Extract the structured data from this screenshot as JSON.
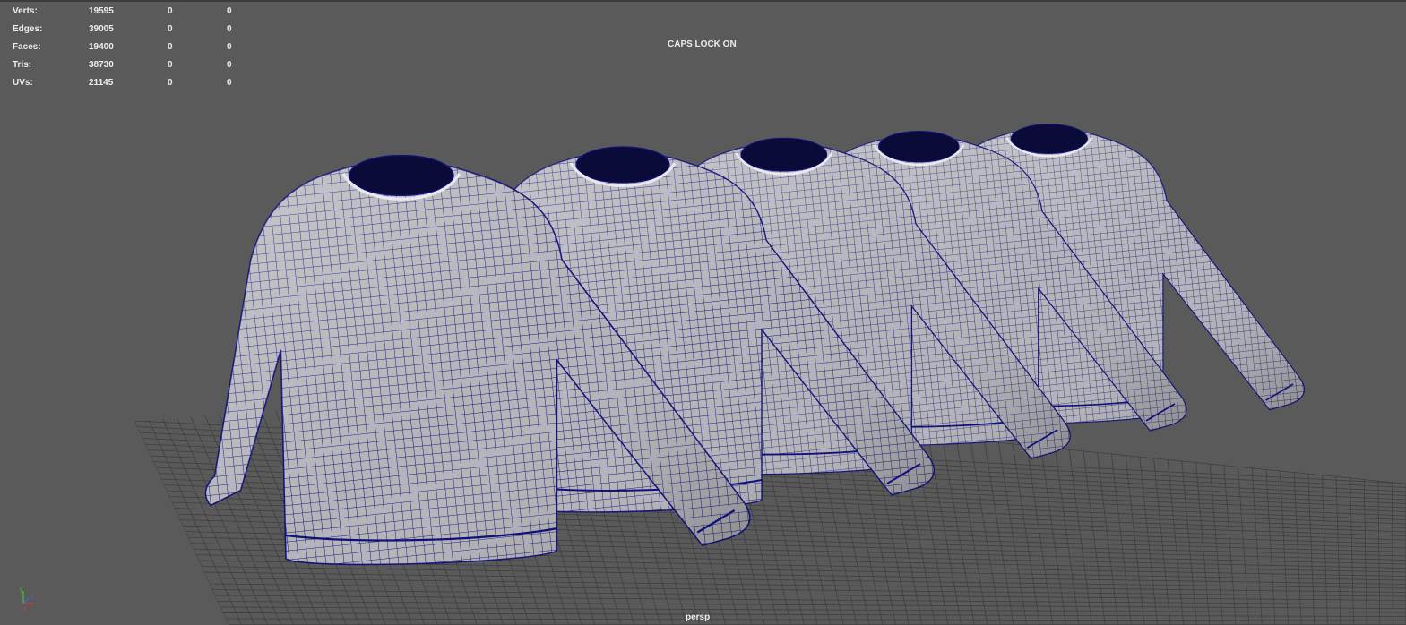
{
  "hud": {
    "rows": [
      {
        "label": "Verts:",
        "total": "19595",
        "selected": "0",
        "components": "0"
      },
      {
        "label": "Edges:",
        "total": "39005",
        "selected": "0",
        "components": "0"
      },
      {
        "label": "Faces:",
        "total": "19400",
        "selected": "0",
        "components": "0"
      },
      {
        "label": "Tris:",
        "total": "38730",
        "selected": "0",
        "components": "0"
      },
      {
        "label": "UVs:",
        "total": "21145",
        "selected": "0",
        "components": "0"
      }
    ]
  },
  "caps_lock": "CAPS LOCK ON",
  "camera": "persp",
  "axis": {
    "y": "y",
    "z": "z",
    "x": "x"
  },
  "colors": {
    "background": "#5a5a5a",
    "grid": "#3f3f3f",
    "wire": "#10107a",
    "mesh_fill": "#b4b4b8",
    "hud_text": "#ececec"
  },
  "scene": {
    "object": "wireframe sweater mesh",
    "count": 5
  }
}
